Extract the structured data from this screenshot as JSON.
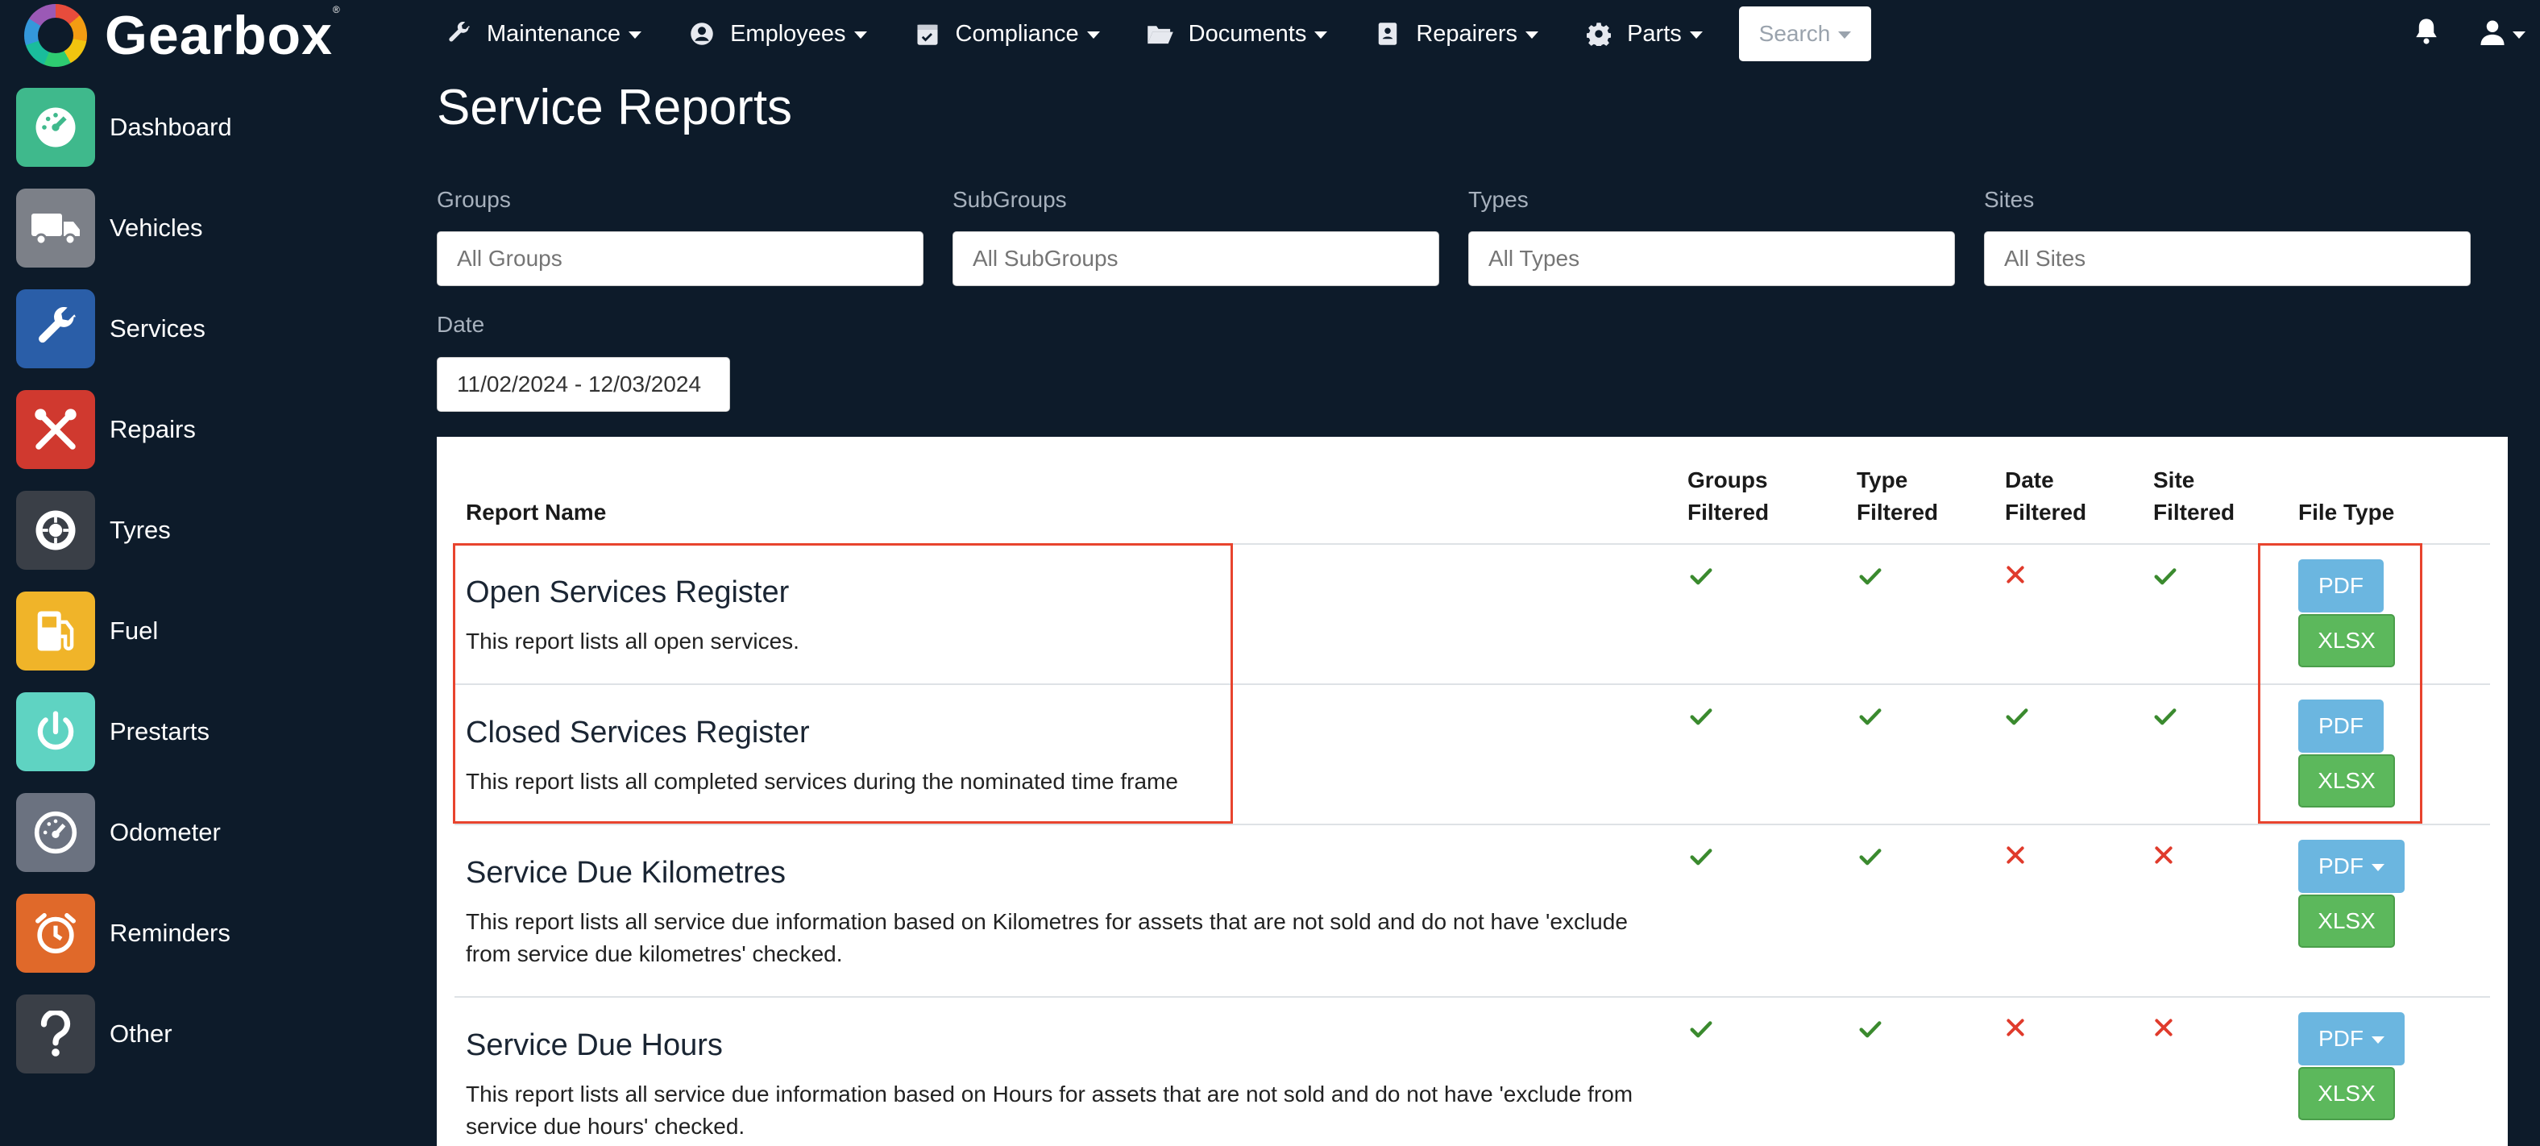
{
  "app": {
    "name": "Gearbox"
  },
  "nav": {
    "items": [
      {
        "label": "Maintenance",
        "icon": "wrench-icon"
      },
      {
        "label": "Employees",
        "icon": "user-circle-icon"
      },
      {
        "label": "Compliance",
        "icon": "calendar-check-icon"
      },
      {
        "label": "Documents",
        "icon": "folder-open-icon"
      },
      {
        "label": "Repairers",
        "icon": "address-book-icon"
      },
      {
        "label": "Parts",
        "icon": "gear-icon"
      }
    ],
    "search_label": "Search"
  },
  "sidebar": {
    "items": [
      {
        "label": "Dashboard",
        "icon": "speedometer-icon",
        "color": "#3fb98c"
      },
      {
        "label": "Vehicles",
        "icon": "truck-icon",
        "color": "#7c8088"
      },
      {
        "label": "Services",
        "icon": "wrench-icon",
        "color": "#2a5ea8"
      },
      {
        "label": "Repairs",
        "icon": "tools-icon",
        "color": "#d0392f"
      },
      {
        "label": "Tyres",
        "icon": "tyre-icon",
        "color": "#3a3f47"
      },
      {
        "label": "Fuel",
        "icon": "fuel-pump-icon",
        "color": "#f0b429"
      },
      {
        "label": "Prestarts",
        "icon": "power-icon",
        "color": "#5fd3c2"
      },
      {
        "label": "Odometer",
        "icon": "gauge-icon",
        "color": "#6b7280"
      },
      {
        "label": "Reminders",
        "icon": "alarm-clock-icon",
        "color": "#e0692a"
      },
      {
        "label": "Other",
        "icon": "question-icon",
        "color": "#3a3f47"
      }
    ]
  },
  "page": {
    "title": "Service Reports"
  },
  "filters": {
    "groups": {
      "label": "Groups",
      "placeholder": "All Groups"
    },
    "subgroups": {
      "label": "SubGroups",
      "placeholder": "All SubGroups"
    },
    "types": {
      "label": "Types",
      "placeholder": "All Types"
    },
    "sites": {
      "label": "Sites",
      "placeholder": "All Sites"
    },
    "date": {
      "label": "Date",
      "value": "11/02/2024 - 12/03/2024"
    }
  },
  "table": {
    "headers": {
      "report_name": "Report Name",
      "groups_1": "Groups",
      "groups_2": "Filtered",
      "type_1": "Type",
      "type_2": "Filtered",
      "date_1": "Date",
      "date_2": "Filtered",
      "site_1": "Site",
      "site_2": "Filtered",
      "file_type": "File Type"
    },
    "rows": [
      {
        "title": "Open Services Register",
        "desc": "This report lists all open services.",
        "groups": true,
        "type": true,
        "date": false,
        "site": true,
        "pdf": "PDF",
        "xlsx": "XLSX",
        "pdf_dropdown": false
      },
      {
        "title": "Closed Services Register",
        "desc": "This report lists all completed services during the nominated time frame",
        "groups": true,
        "type": true,
        "date": true,
        "site": true,
        "pdf": "PDF",
        "xlsx": "XLSX",
        "pdf_dropdown": false
      },
      {
        "title": "Service Due Kilometres",
        "desc": "This report lists all service due information based on Kilometres for assets that are not sold and do not have 'exclude from service due kilometres' checked.",
        "groups": true,
        "type": true,
        "date": false,
        "site": false,
        "pdf": "PDF",
        "xlsx": "XLSX",
        "pdf_dropdown": true
      },
      {
        "title": "Service Due Hours",
        "desc": "This report lists all service due information based on Hours for assets that are not sold and do not have 'exclude from service due hours' checked.",
        "groups": true,
        "type": true,
        "date": false,
        "site": false,
        "pdf": "PDF",
        "xlsx": "XLSX",
        "pdf_dropdown": true
      }
    ]
  },
  "colors": {
    "check": "#3a8a2e",
    "cross": "#e03b2c",
    "highlight": "#e8442e"
  }
}
